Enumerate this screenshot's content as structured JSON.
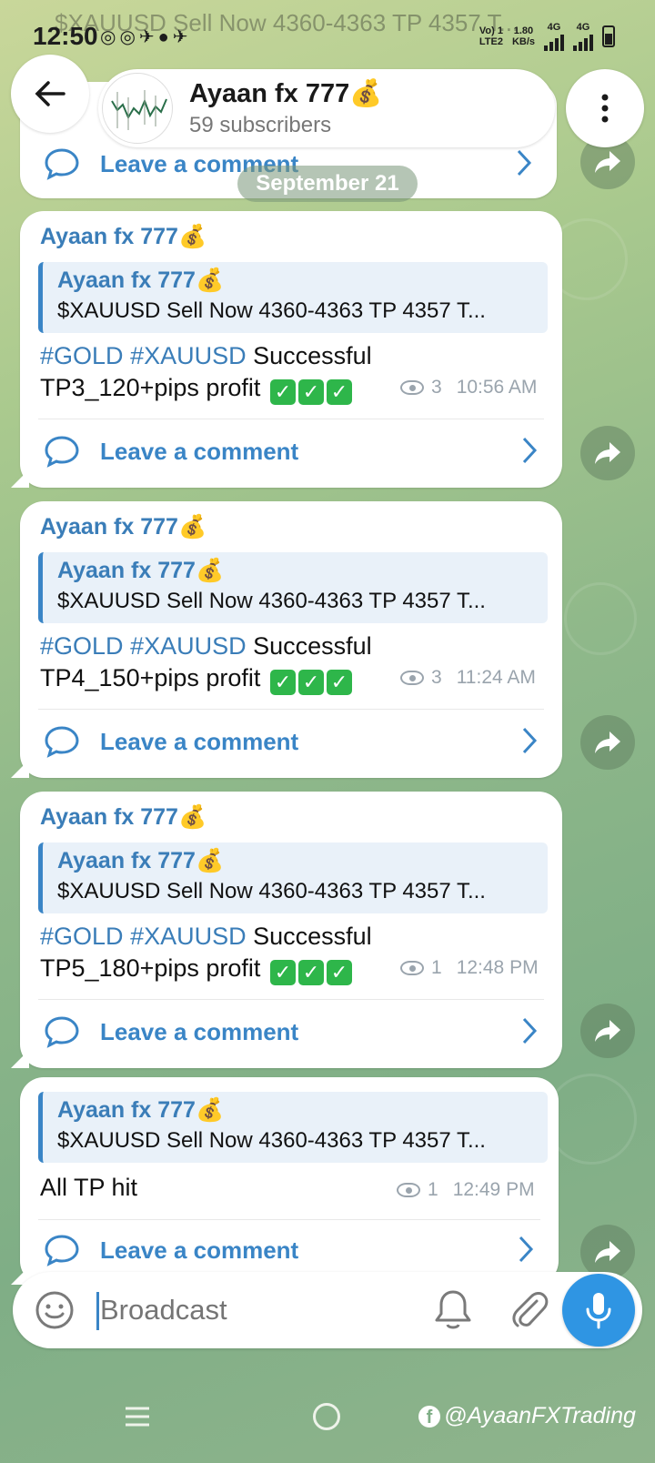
{
  "status_bar": {
    "time": "12:50",
    "net_speed": "1.80",
    "net_unit": "KB/s",
    "volte": "Vo) 1",
    "lte": "LTE2",
    "sim1_type": "4G",
    "sim2_type": "4G"
  },
  "header": {
    "channel_name": "Ayaan fx 777💰",
    "subscribers": "59 subscribers"
  },
  "date_separator": "September 21",
  "top_partial": {
    "comment_label": "Leave a comment"
  },
  "messages": [
    {
      "sender": "Ayaan fx 777💰",
      "reply_name": "Ayaan fx 777💰",
      "reply_text": "$XAUUSD Sell Now 4360-4363  TP 4357 T...",
      "tag1": "#GOLD",
      "tag2": "#XAUUSD",
      "line1_rest": " Successful",
      "line2": "TP3_120+pips profit",
      "views": "3",
      "time": "10:56 AM",
      "comment_label": "Leave a comment"
    },
    {
      "sender": "Ayaan fx 777💰",
      "reply_name": "Ayaan fx 777💰",
      "reply_text": "$XAUUSD Sell Now 4360-4363  TP 4357 T...",
      "tag1": "#GOLD",
      "tag2": "#XAUUSD",
      "line1_rest": " Successful",
      "line2": "TP4_150+pips profit",
      "views": "3",
      "time": "11:24 AM",
      "comment_label": "Leave a comment"
    },
    {
      "sender": "Ayaan fx 777💰",
      "reply_name": "Ayaan fx 777💰",
      "reply_text": "$XAUUSD Sell Now 4360-4363  TP 4357 T...",
      "tag1": "#GOLD",
      "tag2": "#XAUUSD",
      "line1_rest": " Successful",
      "line2": "TP5_180+pips profit",
      "views": "1",
      "time": "12:48 PM",
      "comment_label": "Leave a comment"
    },
    {
      "reply_name": "Ayaan fx 777💰",
      "reply_text": "$XAUUSD Sell Now 4360-4363  TP 4357 T...",
      "text": "All TP hit",
      "views": "1",
      "time": "12:49 PM",
      "comment_label": "Leave a comment"
    }
  ],
  "composer": {
    "placeholder": "Broadcast"
  },
  "watermark": "@AyaanFXTrading",
  "icons": {
    "back": "arrow-left-icon",
    "menu": "more-vertical-icon",
    "comment": "comment-bubble-icon",
    "share": "share-arrow-icon",
    "emoji": "smiley-icon",
    "bell": "bell-icon",
    "attach": "paperclip-icon",
    "mic": "microphone-icon",
    "views": "eye-icon",
    "check": "check-box-icon"
  },
  "colors": {
    "accent": "#3a85c6",
    "mic_button": "#2f95e3",
    "check_green": "#2eb64a"
  }
}
